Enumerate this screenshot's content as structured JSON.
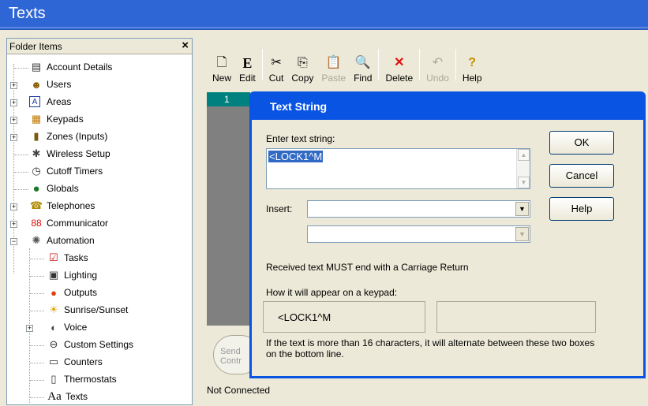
{
  "window": {
    "title": "Texts"
  },
  "folder_panel": {
    "title": "Folder Items",
    "close_glyph": "×",
    "items": [
      {
        "label": "Account Details",
        "icon": "account-details-icon",
        "glyph": "▤"
      },
      {
        "label": "Users",
        "icon": "users-icon",
        "glyph": "☻"
      },
      {
        "label": "Areas",
        "icon": "areas-icon",
        "glyph": "A"
      },
      {
        "label": "Keypads",
        "icon": "keypads-icon",
        "glyph": "▦"
      },
      {
        "label": "Zones (Inputs)",
        "icon": "zones-icon",
        "glyph": "▮"
      },
      {
        "label": "Wireless Setup",
        "icon": "wireless-icon",
        "glyph": "✱"
      },
      {
        "label": "Cutoff Timers",
        "icon": "cutoff-timers-icon",
        "glyph": "◷"
      },
      {
        "label": "Globals",
        "icon": "globals-icon",
        "glyph": "●"
      },
      {
        "label": "Telephones",
        "icon": "telephones-icon",
        "glyph": "☎"
      },
      {
        "label": "Communicator",
        "icon": "communicator-icon",
        "glyph": "88"
      },
      {
        "label": "Automation",
        "icon": "automation-icon",
        "glyph": "✺"
      },
      {
        "label": "Tasks",
        "icon": "tasks-icon",
        "glyph": "☑"
      },
      {
        "label": "Lighting",
        "icon": "lighting-icon",
        "glyph": "▣"
      },
      {
        "label": "Outputs",
        "icon": "outputs-icon",
        "glyph": "●"
      },
      {
        "label": "Sunrise/Sunset",
        "icon": "sunrise-sunset-icon",
        "glyph": "☀"
      },
      {
        "label": "Voice",
        "icon": "voice-icon",
        "glyph": "◐"
      },
      {
        "label": "Custom Settings",
        "icon": "custom-settings-icon",
        "glyph": "⊖"
      },
      {
        "label": "Counters",
        "icon": "counters-icon",
        "glyph": "▭"
      },
      {
        "label": "Thermostats",
        "icon": "thermostats-icon",
        "glyph": "▯"
      },
      {
        "label": "Texts",
        "icon": "texts-icon",
        "glyph": "Aa"
      }
    ]
  },
  "toolbar": {
    "new": "New",
    "edit": "Edit",
    "cut": "Cut",
    "copy": "Copy",
    "paste": "Paste",
    "find": "Find",
    "delete": "Delete",
    "undo": "Undo",
    "help": "Help"
  },
  "grid": {
    "row1": "1"
  },
  "send_button": {
    "line1": "Send",
    "line2": "Contr"
  },
  "status": "Not Connected",
  "dialog": {
    "title": "Text String",
    "enter_label": "Enter text string:",
    "text_value": "<LOCK1^M",
    "ok": "OK",
    "cancel": "Cancel",
    "help": "Help",
    "insert_label": "Insert:",
    "insert_value": "",
    "second_value": "",
    "note": "Received text MUST end with a Carriage Return",
    "keypad_label": "How it will appear on a keypad:",
    "keypad_line1": "<LOCK1^M",
    "keypad_line2": "",
    "footer": "If the text is more than 16 characters, it will alternate between these two boxes on the bottom line."
  },
  "colors": {
    "title_bar": "#2f66d6",
    "dialog_title": "#0a54e3",
    "grid_cell": "#00807f"
  }
}
